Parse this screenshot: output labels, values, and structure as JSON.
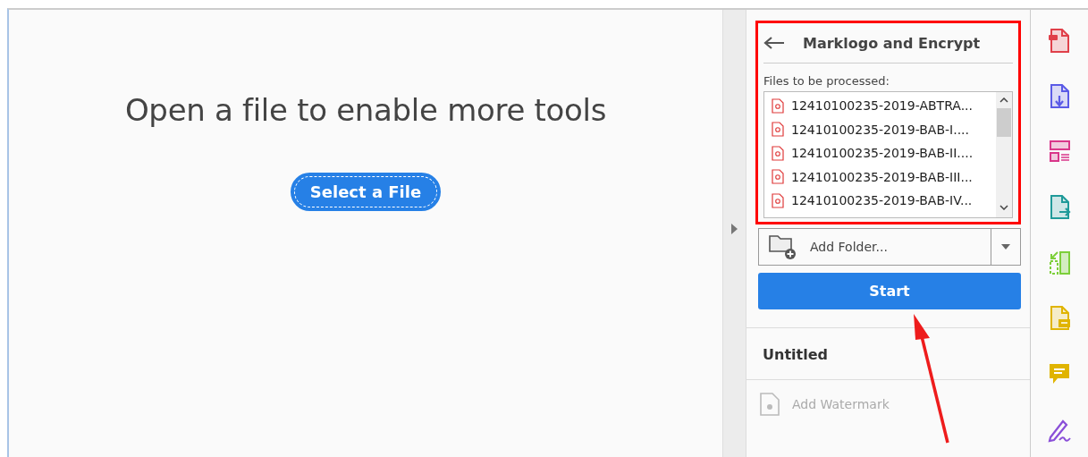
{
  "main": {
    "message": "Open a file to enable more tools",
    "button": "Select a File"
  },
  "panel": {
    "title": "Marklogo and Encrypt",
    "files_label": "Files to be processed:",
    "files": [
      {
        "name": "12410100235-2019-ABTRA..."
      },
      {
        "name": "12410100235-2019-BAB-I...."
      },
      {
        "name": "12410100235-2019-BAB-II...."
      },
      {
        "name": "12410100235-2019-BAB-III..."
      },
      {
        "name": "12410100235-2019-BAB-IV..."
      }
    ],
    "add_button": "Add Folder...",
    "start_button": "Start",
    "section": "Untitled",
    "actions": [
      {
        "label": "Add Watermark",
        "disabled": true
      }
    ]
  },
  "rail": [
    {
      "kind": "create"
    },
    {
      "kind": "combine"
    },
    {
      "kind": "organize"
    },
    {
      "kind": "export"
    },
    {
      "kind": "compare"
    },
    {
      "kind": "comment-file"
    },
    {
      "kind": "comment"
    },
    {
      "kind": "sign"
    }
  ]
}
